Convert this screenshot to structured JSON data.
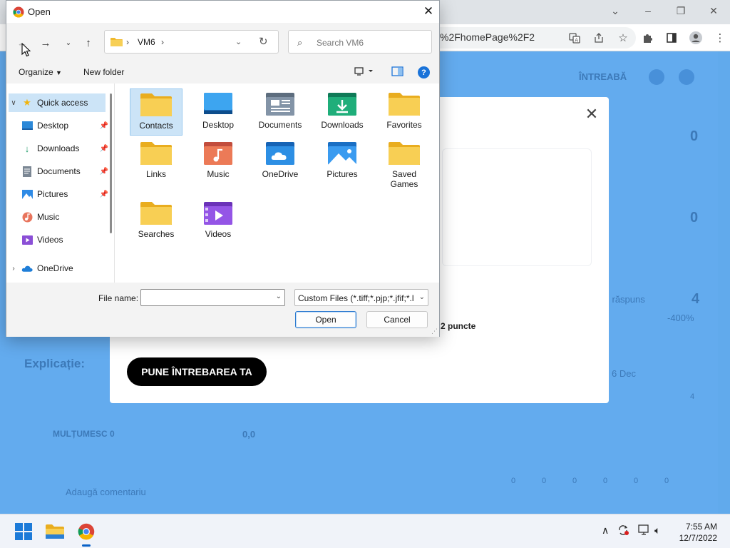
{
  "browser": {
    "url_fragment": "%2FhomePage%2F2",
    "controls": [
      "⌄",
      "–",
      "❐",
      "✕"
    ],
    "icons": [
      "translate-icon",
      "share-icon",
      "bookmark-star-icon",
      "extensions-icon",
      "sidepanel-icon",
      "profile-icon",
      "menu-icon"
    ]
  },
  "page_background": {
    "intreaba": "ÎNTREABĂ",
    "score_top": "0",
    "score_mid": "0",
    "raspuns": "l răspuns",
    "score_four": "4",
    "percent": "-400%",
    "date": "6 Dec",
    "explicatie": "Explicație:",
    "multumesc": "MULȚUMESC 0",
    "rating": "0,0",
    "comment": "Adaugă comentariu",
    "side_four": "4",
    "zeros": [
      "0",
      "0",
      "0",
      "0",
      "0",
      "0"
    ]
  },
  "modal": {
    "points": "2 puncte",
    "ask_button": "PUNE ÎNTREBAREA TA"
  },
  "dialog": {
    "title": "Open",
    "address": {
      "location": "VM6"
    },
    "search_placeholder": "Search VM6",
    "commands": {
      "organize": "Organize",
      "new_folder": "New folder"
    },
    "nav_tree": [
      {
        "label": "Quick access",
        "icon": "star-icon",
        "expanded": true,
        "selected": true
      },
      {
        "label": "Desktop",
        "icon": "desktop-icon",
        "pinned": true
      },
      {
        "label": "Downloads",
        "icon": "download-icon",
        "pinned": true
      },
      {
        "label": "Documents",
        "icon": "documents-icon",
        "pinned": true
      },
      {
        "label": "Pictures",
        "icon": "pictures-icon",
        "pinned": true
      },
      {
        "label": "Music",
        "icon": "music-icon"
      },
      {
        "label": "Videos",
        "icon": "videos-icon"
      },
      {
        "label": "OneDrive",
        "icon": "onedrive-icon",
        "expandable": true
      }
    ],
    "files": [
      {
        "label": "Contacts",
        "icon": "folder-icon",
        "selected": true
      },
      {
        "label": "Desktop",
        "icon": "desktop-folder-icon"
      },
      {
        "label": "Documents",
        "icon": "documents-folder-icon"
      },
      {
        "label": "Downloads",
        "icon": "downloads-folder-icon"
      },
      {
        "label": "Favorites",
        "icon": "folder-icon"
      },
      {
        "label": "Links",
        "icon": "folder-icon"
      },
      {
        "label": "Music",
        "icon": "music-folder-icon"
      },
      {
        "label": "OneDrive",
        "icon": "onedrive-folder-icon"
      },
      {
        "label": "Pictures",
        "icon": "pictures-folder-icon"
      },
      {
        "label": "Saved Games",
        "icon": "folder-icon"
      },
      {
        "label": "Searches",
        "icon": "folder-icon"
      },
      {
        "label": "Videos",
        "icon": "videos-folder-icon"
      }
    ],
    "file_name_label": "File name:",
    "file_name_value": "",
    "filter": "Custom Files (*.tiff;*.pjp;*.jfif;*.l",
    "open_button": "Open",
    "cancel_button": "Cancel"
  },
  "taskbar": {
    "time": "7:55 AM",
    "date": "12/7/2022",
    "apps": [
      "start-icon",
      "file-explorer-icon",
      "chrome-icon"
    ]
  },
  "colors": {
    "overlay": "#4a9eeb",
    "selection": "#cce4f7",
    "folder_yellow": "#f7c948",
    "accent": "#1a73d9"
  }
}
